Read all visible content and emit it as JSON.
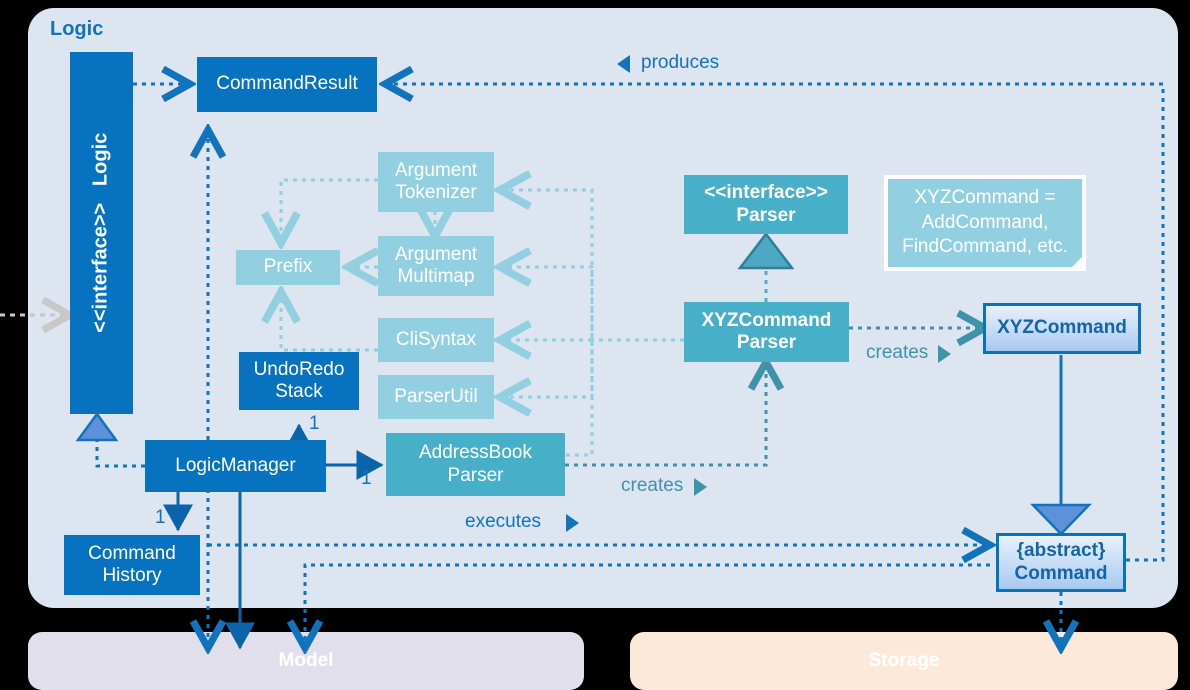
{
  "diagram": {
    "title": "Logic",
    "background": "#000000",
    "panel_fill": "#dce5f0",
    "colors": {
      "blue": "#0773c0",
      "teal": "#48afc8",
      "light_teal": "#92cfe0",
      "label_blue": "#1273bd",
      "label_teal": "#3f93a8",
      "model_fill": "#e2dfec",
      "storage_fill": "#fce9da"
    }
  },
  "interface_logic": {
    "stereotype": "<<interface>>",
    "name": "Logic"
  },
  "classes": {
    "command_result": "CommandResult",
    "argument_tokenizer_l1": "Argument",
    "argument_tokenizer_l2": "Tokenizer",
    "argument_multimap_l1": "Argument",
    "argument_multimap_l2": "Multimap",
    "prefix": "Prefix",
    "cli_syntax": "CliSyntax",
    "parser_util": "ParserUtil",
    "undo_redo_stack_l1": "UndoRedo",
    "undo_redo_stack_l2": "Stack",
    "logic_manager": "LogicManager",
    "address_book_parser_l1": "AddressBook",
    "address_book_parser_l2": "Parser",
    "command_history_l1": "Command",
    "command_history_l2": "History",
    "parser_iface_stereotype": "<<interface>>",
    "parser_iface_name": "Parser",
    "xyz_command_parser_l1": "XYZCommand",
    "xyz_command_parser_l2": "Parser",
    "xyz_command": "XYZCommand",
    "abstract_command_l1": "{abstract}",
    "abstract_command_l2": "Command"
  },
  "note": {
    "line1": "XYZCommand =",
    "line2": "AddCommand,",
    "line3": "FindCommand, etc."
  },
  "edge_labels": {
    "produces": "produces",
    "creates_parser": "creates",
    "creates_abp": "creates",
    "executes": "executes"
  },
  "multiplicities": {
    "undo_redo_stack": "1",
    "address_book_parser": "1",
    "command_history": "1"
  },
  "external_panels": {
    "model": "Model",
    "storage": "Storage"
  }
}
